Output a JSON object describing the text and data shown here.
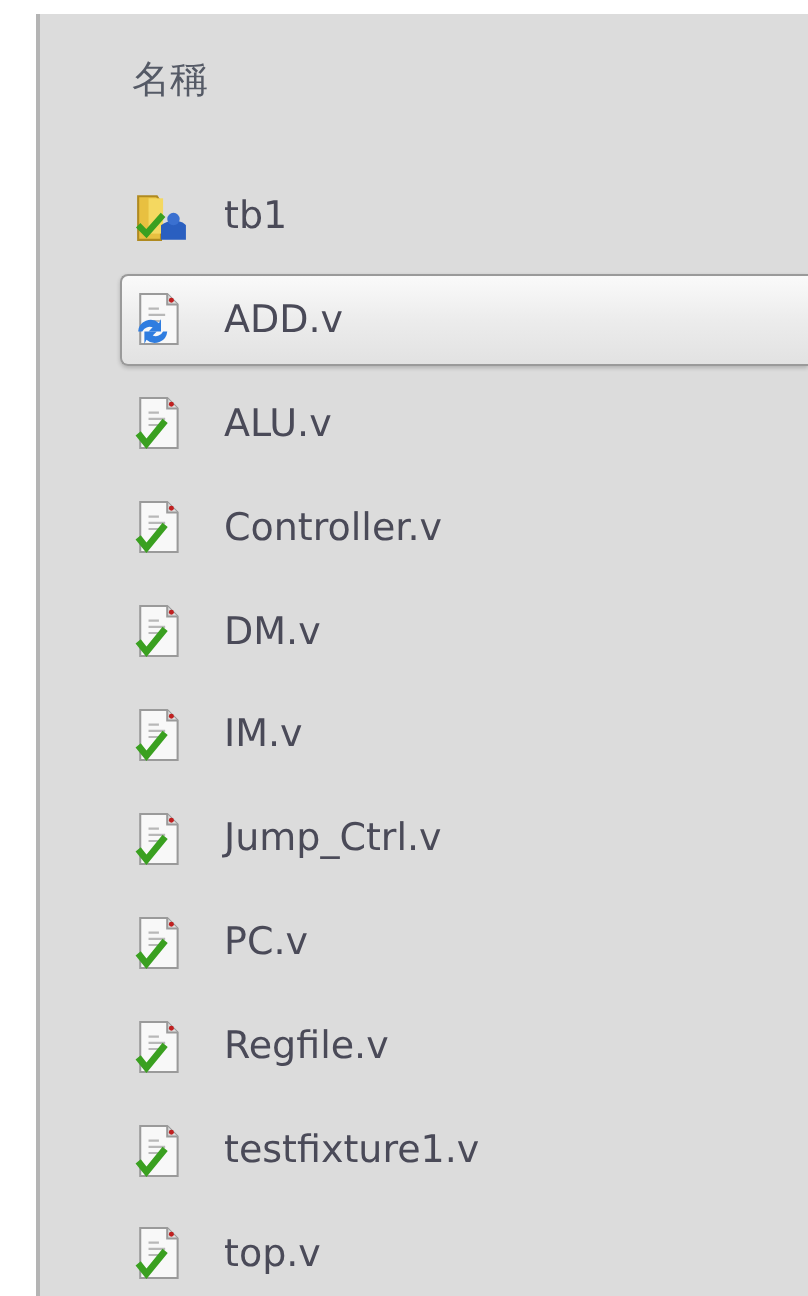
{
  "header": {
    "label": "名稱"
  },
  "items": [
    {
      "name": "tb1",
      "kind": "folder",
      "selected": false
    },
    {
      "name": "ADD.v",
      "kind": "file-sync",
      "selected": true
    },
    {
      "name": "ALU.v",
      "kind": "file-check",
      "selected": false
    },
    {
      "name": "Controller.v",
      "kind": "file-check",
      "selected": false
    },
    {
      "name": "DM.v",
      "kind": "file-check",
      "selected": false
    },
    {
      "name": "IM.v",
      "kind": "file-check",
      "selected": false
    },
    {
      "name": "Jump_Ctrl.v",
      "kind": "file-check",
      "selected": false
    },
    {
      "name": "PC.v",
      "kind": "file-check",
      "selected": false
    },
    {
      "name": "Regfile.v",
      "kind": "file-check",
      "selected": false
    },
    {
      "name": "testfixture1.v",
      "kind": "file-check",
      "selected": false
    },
    {
      "name": "top.v",
      "kind": "file-check",
      "selected": false
    }
  ]
}
